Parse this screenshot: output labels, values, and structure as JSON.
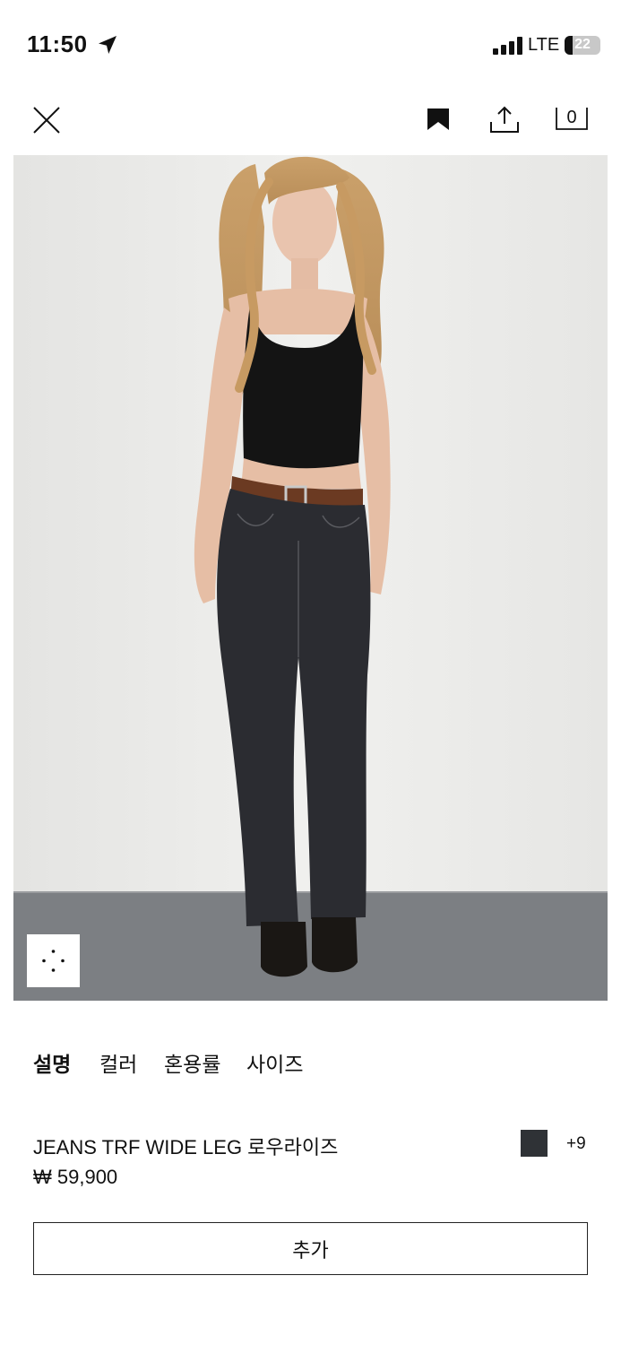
{
  "status_bar": {
    "time": "11:50",
    "network": "LTE",
    "battery": "22",
    "battery_level_percent": 22,
    "icons": [
      "location-arrow-icon",
      "signal-icon",
      "battery-icon"
    ]
  },
  "toolbar": {
    "icons": [
      "close-icon",
      "bookmark-icon",
      "share-icon",
      "shopping-bag-icon"
    ],
    "bag_count": "0"
  },
  "product": {
    "image_icon": "zoom-dots-icon",
    "tabs": [
      {
        "label": "설명",
        "active": true
      },
      {
        "label": "컬러",
        "active": false
      },
      {
        "label": "혼용률",
        "active": false
      },
      {
        "label": "사이즈",
        "active": false
      }
    ],
    "name": "JEANS TRF WIDE LEG 로우라이즈",
    "price": "₩ 59,900",
    "color_swatch": "#2f3236",
    "more_colors": "+9",
    "add_button": "추가"
  }
}
